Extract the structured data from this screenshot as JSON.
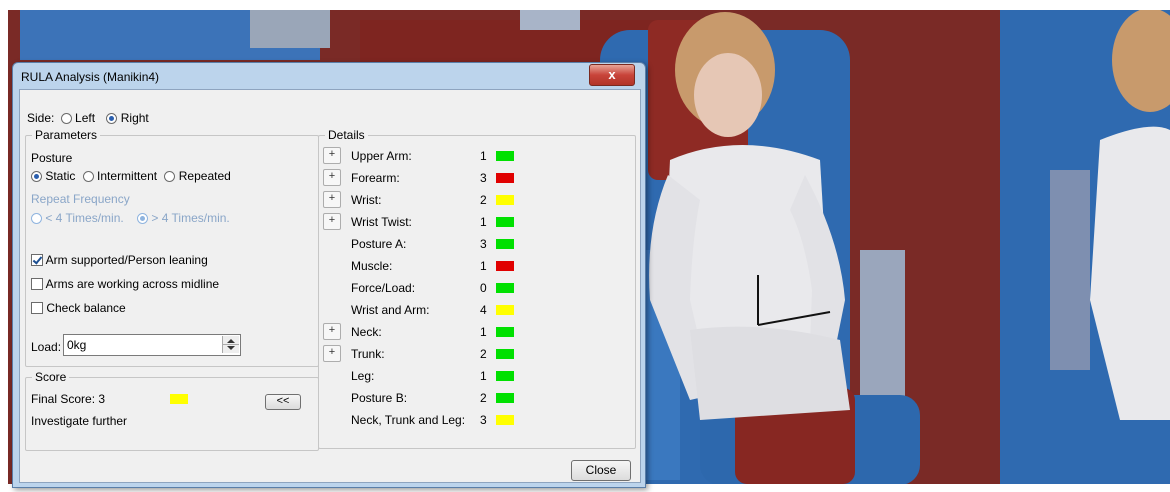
{
  "window": {
    "title": "RULA Analysis (Manikin4)",
    "close_glyph": "x"
  },
  "side": {
    "label": "Side:",
    "options": [
      "Left",
      "Right"
    ],
    "selected": "Right"
  },
  "parameters": {
    "legend": "Parameters",
    "posture": {
      "label": "Posture",
      "options": [
        "Static",
        "Intermittent",
        "Repeated"
      ],
      "selected": "Static"
    },
    "repeat_frequency": {
      "label": "Repeat Frequency",
      "options": [
        "< 4 Times/min.",
        "> 4 Times/min."
      ],
      "selected": "> 4 Times/min."
    },
    "checks": [
      {
        "label": "Arm supported/Person leaning",
        "checked": true
      },
      {
        "label": "Arms are working across midline",
        "checked": false
      },
      {
        "label": "Check balance",
        "checked": false
      }
    ],
    "load": {
      "label": "Load:",
      "value": "0kg"
    }
  },
  "score": {
    "legend": "Score",
    "final_label": "Final Score: 3",
    "final_color": "#ffff00",
    "verdict": "Investigate further",
    "collapse_label": "<<"
  },
  "details": {
    "legend": "Details",
    "rows": [
      {
        "label": "Upper Arm:",
        "value": "1",
        "color": "#00e000",
        "expandable": true
      },
      {
        "label": "Forearm:",
        "value": "3",
        "color": "#e00000",
        "expandable": true
      },
      {
        "label": "Wrist:",
        "value": "2",
        "color": "#ffff00",
        "expandable": true
      },
      {
        "label": "Wrist Twist:",
        "value": "1",
        "color": "#00e000",
        "expandable": true
      },
      {
        "label": "Posture A:",
        "value": "3",
        "color": "#00e000",
        "expandable": false
      },
      {
        "label": "Muscle:",
        "value": "1",
        "color": "#e00000",
        "expandable": false
      },
      {
        "label": "Force/Load:",
        "value": "0",
        "color": "#00e000",
        "expandable": false
      },
      {
        "label": "Wrist and Arm:",
        "value": "4",
        "color": "#ffff00",
        "expandable": false
      },
      {
        "label": "Neck:",
        "value": "1",
        "color": "#00e000",
        "expandable": true
      },
      {
        "label": "Trunk:",
        "value": "2",
        "color": "#00e000",
        "expandable": true
      },
      {
        "label": "Leg:",
        "value": "1",
        "color": "#00e000",
        "expandable": false
      },
      {
        "label": "Posture B:",
        "value": "2",
        "color": "#00e000",
        "expandable": false
      },
      {
        "label": "Neck, Trunk and Leg:",
        "value": "3",
        "color": "#ffff00",
        "expandable": false
      }
    ],
    "expand_glyph": "+"
  },
  "footer": {
    "close_label": "Close"
  },
  "colors": {
    "dialog_frame": "#bcd4ec",
    "client_bg": "#f0f0f0",
    "scene_bg": "#7a2a26"
  }
}
